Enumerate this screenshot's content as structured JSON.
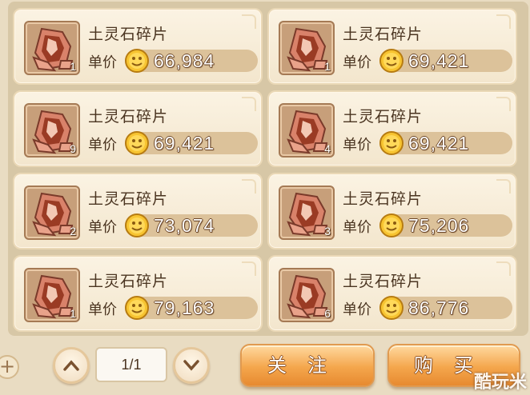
{
  "items": [
    {
      "name": "土灵石碎片",
      "price_label": "单价",
      "price": "66,984",
      "qty": "1"
    },
    {
      "name": "土灵石碎片",
      "price_label": "单价",
      "price": "69,421",
      "qty": "1"
    },
    {
      "name": "土灵石碎片",
      "price_label": "单价",
      "price": "69,421",
      "qty": "9"
    },
    {
      "name": "土灵石碎片",
      "price_label": "单价",
      "price": "69,421",
      "qty": "4"
    },
    {
      "name": "土灵石碎片",
      "price_label": "单价",
      "price": "73,074",
      "qty": "2"
    },
    {
      "name": "土灵石碎片",
      "price_label": "单价",
      "price": "75,206",
      "qty": "3"
    },
    {
      "name": "土灵石碎片",
      "price_label": "单价",
      "price": "79,163",
      "qty": "1"
    },
    {
      "name": "土灵石碎片",
      "price_label": "单价",
      "price": "86,776",
      "qty": "6"
    }
  ],
  "pager": {
    "page": "1/1"
  },
  "buttons": {
    "follow": "关注",
    "buy": "购买"
  },
  "watermark": "酷玩米",
  "icons": {
    "add": "plus-icon",
    "prev": "chevron-up-icon",
    "next": "chevron-down-icon",
    "coin": "gold-coin-icon",
    "item": "earth-spirit-stone-shard-icon"
  },
  "colors": {
    "accent": "#f4a64c",
    "card_bg": "#fbf3e3",
    "price_bar": "#dcc29a"
  }
}
